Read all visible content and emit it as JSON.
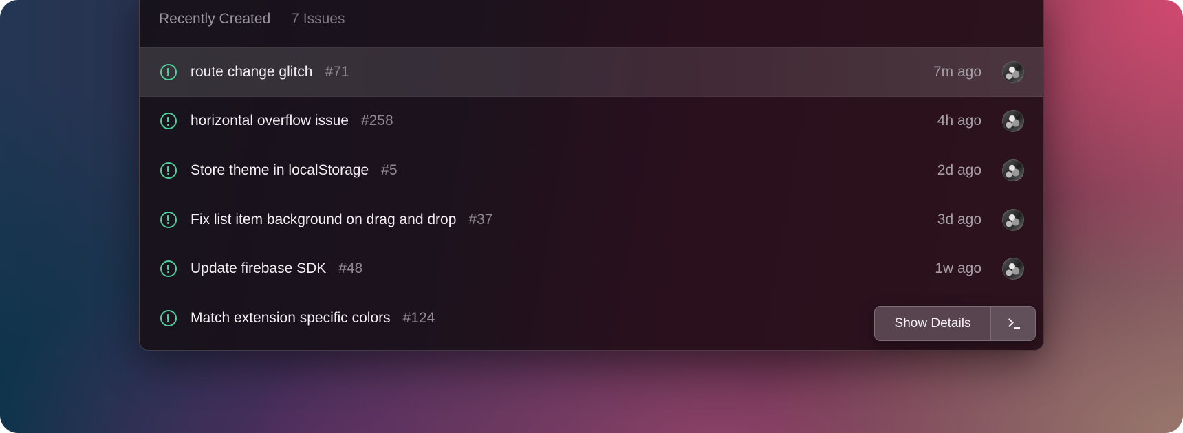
{
  "section": {
    "title": "Recently Created",
    "count": "7 Issues"
  },
  "colors": {
    "status_open": "#4fcf9a",
    "panel_bg": "#1c121d"
  },
  "issues": [
    {
      "title": "route change glitch",
      "number": "#71",
      "time": "7m ago",
      "icon": "open-issue-icon",
      "selected": true
    },
    {
      "title": "horizontal overflow issue",
      "number": "#258",
      "time": "4h ago",
      "icon": "open-issue-icon",
      "selected": false
    },
    {
      "title": "Store theme in localStorage",
      "number": "#5",
      "time": "2d ago",
      "icon": "open-issue-icon",
      "selected": false
    },
    {
      "title": "Fix list item background on drag and drop",
      "number": "#37",
      "time": "3d ago",
      "icon": "open-issue-icon",
      "selected": false
    },
    {
      "title": "Update firebase SDK",
      "number": "#48",
      "time": "1w ago",
      "icon": "open-issue-icon",
      "selected": false
    },
    {
      "title": "Match extension specific colors",
      "number": "#124",
      "time": "",
      "icon": "open-issue-icon",
      "selected": false
    }
  ],
  "actions": {
    "show_details_label": "Show Details",
    "terminal_icon": "terminal-icon"
  }
}
